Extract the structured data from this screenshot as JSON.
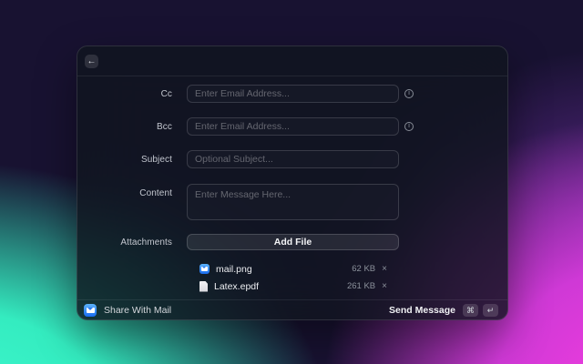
{
  "window": {
    "back_label": "←"
  },
  "form": {
    "cc": {
      "label": "Cc",
      "placeholder": "Enter Email Address..."
    },
    "bcc": {
      "label": "Bcc",
      "placeholder": "Enter Email Address..."
    },
    "subject": {
      "label": "Subject",
      "placeholder": "Optional Subject..."
    },
    "content": {
      "label": "Content",
      "placeholder": "Enter Message Here..."
    },
    "attachments": {
      "label": "Attachments",
      "add_file_label": "Add File"
    },
    "info_glyph": "i"
  },
  "attachments_list": [
    {
      "name": "mail.png",
      "size": "62 KB",
      "icon": "mail-app-icon",
      "remove_label": "×"
    },
    {
      "name": "Latex.epdf",
      "size": "261 KB",
      "icon": "document-icon",
      "remove_label": "×"
    }
  ],
  "footer": {
    "app_icon": "mail-app-icon",
    "app_title": "Share With Mail",
    "primary_action": "Send Message",
    "shortcuts": [
      "⌘",
      "↵"
    ]
  },
  "colors": {
    "mail_icon_blue": "#1f6df0",
    "background_green": "#3ffad1",
    "background_magenta": "#e83cd9",
    "background_dark": "#181231",
    "panel_background": "rgba(16,21,30,0.80)"
  }
}
